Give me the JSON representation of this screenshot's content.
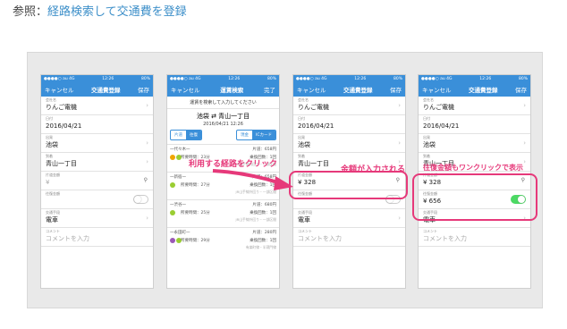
{
  "reference": {
    "prefix": "参照：",
    "link": "経路検索して交通費を登録"
  },
  "status_bar": {
    "carrier": "●●●●○ au 4G",
    "time": "12:26",
    "battery": "80%"
  },
  "screens": [
    {
      "nav": {
        "left": "キャンセル",
        "title": "交通費登録",
        "right": "保存"
      },
      "rows": [
        {
          "label": "会社名",
          "value": "りんご電機"
        },
        {
          "label": "日付",
          "value": "2016/04/21"
        },
        {
          "label": "出発",
          "value": "池袋"
        },
        {
          "label": "到着",
          "value": "青山一丁目"
        },
        {
          "label": "片道金額",
          "value": "¥",
          "placeholder": true
        },
        {
          "label": "往復金額",
          "value": "",
          "toggle": "off"
        },
        {
          "label": "交通手段",
          "value": "電車"
        },
        {
          "label": "コメント",
          "value": "コメントを入力",
          "placeholder": true
        }
      ]
    },
    {
      "nav": {
        "left": "キャンセル",
        "title": "運賃検索",
        "right": "完了"
      },
      "banner": "運賃を検索して入力してください",
      "route_from": "池袋",
      "route_arrow": "⇄",
      "route_to": "青山一丁目",
      "date": "2016/04/21 12:26",
      "seg_left": [
        "片道",
        "往復"
      ],
      "seg_right": [
        "現金",
        "ICカード"
      ],
      "results": [
        {
          "top": "一代々木一",
          "fare": "片道：658円",
          "time": "所要時間：23分",
          "transfer": "乗換回数：1回",
          "note": "JR山手線内回り・一部区間"
        },
        {
          "top": "一新宿一",
          "fare": "片道：658円",
          "time": "所要時間：27分",
          "transfer": "乗換回数：1回",
          "note": "JR山手線外回り・一部区間"
        },
        {
          "top": "一渋谷一",
          "fare": "片道：680円",
          "time": "所要時間：25分",
          "transfer": "乗換回数：1回",
          "note": "JR山手線外回り・一部区間"
        },
        {
          "top": "一永田町一",
          "fare": "片道：280円",
          "time": "所要時間：29分",
          "transfer": "乗換回数：1回",
          "note": "有楽町線・半蔵門線"
        }
      ]
    },
    {
      "nav": {
        "left": "キャンセル",
        "title": "交通費登録",
        "right": "保存"
      },
      "rows": [
        {
          "label": "会社名",
          "value": "りんご電機"
        },
        {
          "label": "日付",
          "value": "2016/04/21"
        },
        {
          "label": "出発",
          "value": "池袋"
        },
        {
          "label": "到着",
          "value": "青山一丁目"
        },
        {
          "label": "片道金額",
          "value": "¥ 328"
        },
        {
          "label": "往復金額",
          "value": "",
          "toggle": "off"
        },
        {
          "label": "交通手段",
          "value": "電車"
        },
        {
          "label": "コメント",
          "value": "コメントを入力",
          "placeholder": true
        }
      ]
    },
    {
      "nav": {
        "left": "キャンセル",
        "title": "交通費登録",
        "right": "保存"
      },
      "rows": [
        {
          "label": "会社名",
          "value": "りんご電機"
        },
        {
          "label": "日付",
          "value": "2016/04/21"
        },
        {
          "label": "出発",
          "value": "池袋"
        },
        {
          "label": "到着",
          "value": "青山一丁目"
        },
        {
          "label": "片道金額",
          "value": "¥ 328"
        },
        {
          "label": "往復金額",
          "value": "¥ 656",
          "toggle": "on"
        },
        {
          "label": "交通手段",
          "value": "電車"
        },
        {
          "label": "コメント",
          "value": "コメントを入力",
          "placeholder": true
        }
      ]
    }
  ],
  "callouts": {
    "route_click": "利用する経路をクリック",
    "amount_entered": "金額が入力される",
    "roundtrip": "往復金額もワンクリックで表示"
  },
  "colors": {
    "accent": "#3a8fd9",
    "callout": "#e6397a",
    "toggle_on": "#4cd964"
  }
}
